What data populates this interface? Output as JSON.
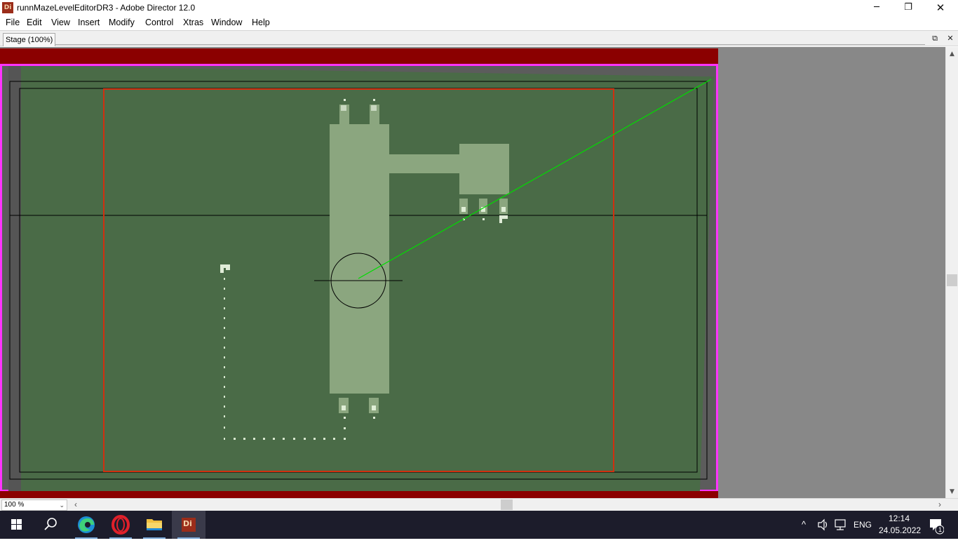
{
  "window": {
    "title": "runnMazeLevelEditorDR3 - Adobe Director 12.0",
    "app_icon_label": "Di",
    "controls": {
      "minimize": "─",
      "restore": "❐",
      "close": "✕"
    }
  },
  "menu": {
    "items": [
      "File",
      "Edit",
      "View",
      "Insert",
      "Modify",
      "Control",
      "Xtras",
      "Window",
      "Help"
    ]
  },
  "stage_panel": {
    "tab_label": "Stage (100%)",
    "restore_icon": "⧉",
    "close_icon": "✕"
  },
  "stage": {
    "colors": {
      "border_magenta": "#ff33ff",
      "top_bar": "#8b0000",
      "field_green": "#4a6b47",
      "light_shape": "#8ba67f",
      "red_frame": "#d03010",
      "guide_line": "#00dd00",
      "outside": "#888888"
    }
  },
  "scrollbars": {
    "up_arrow": "▲",
    "down_arrow": "▼",
    "left_arrow": "‹",
    "right_arrow": "›"
  },
  "zoom": {
    "value": "100 %",
    "arrow": "⌄"
  },
  "taskbar": {
    "apps": [
      {
        "name": "start",
        "icon": "windows-logo"
      },
      {
        "name": "search",
        "icon": "search-icon"
      },
      {
        "name": "edge",
        "icon": "edge-icon"
      },
      {
        "name": "opera",
        "icon": "opera-icon"
      },
      {
        "name": "explorer",
        "icon": "folder-icon"
      },
      {
        "name": "director",
        "icon": "director-icon",
        "label": "Di"
      }
    ],
    "tray": {
      "chevron": "^",
      "language": "ENG",
      "time": "12:14",
      "date": "24.05.2022",
      "notification_count": "1"
    }
  }
}
